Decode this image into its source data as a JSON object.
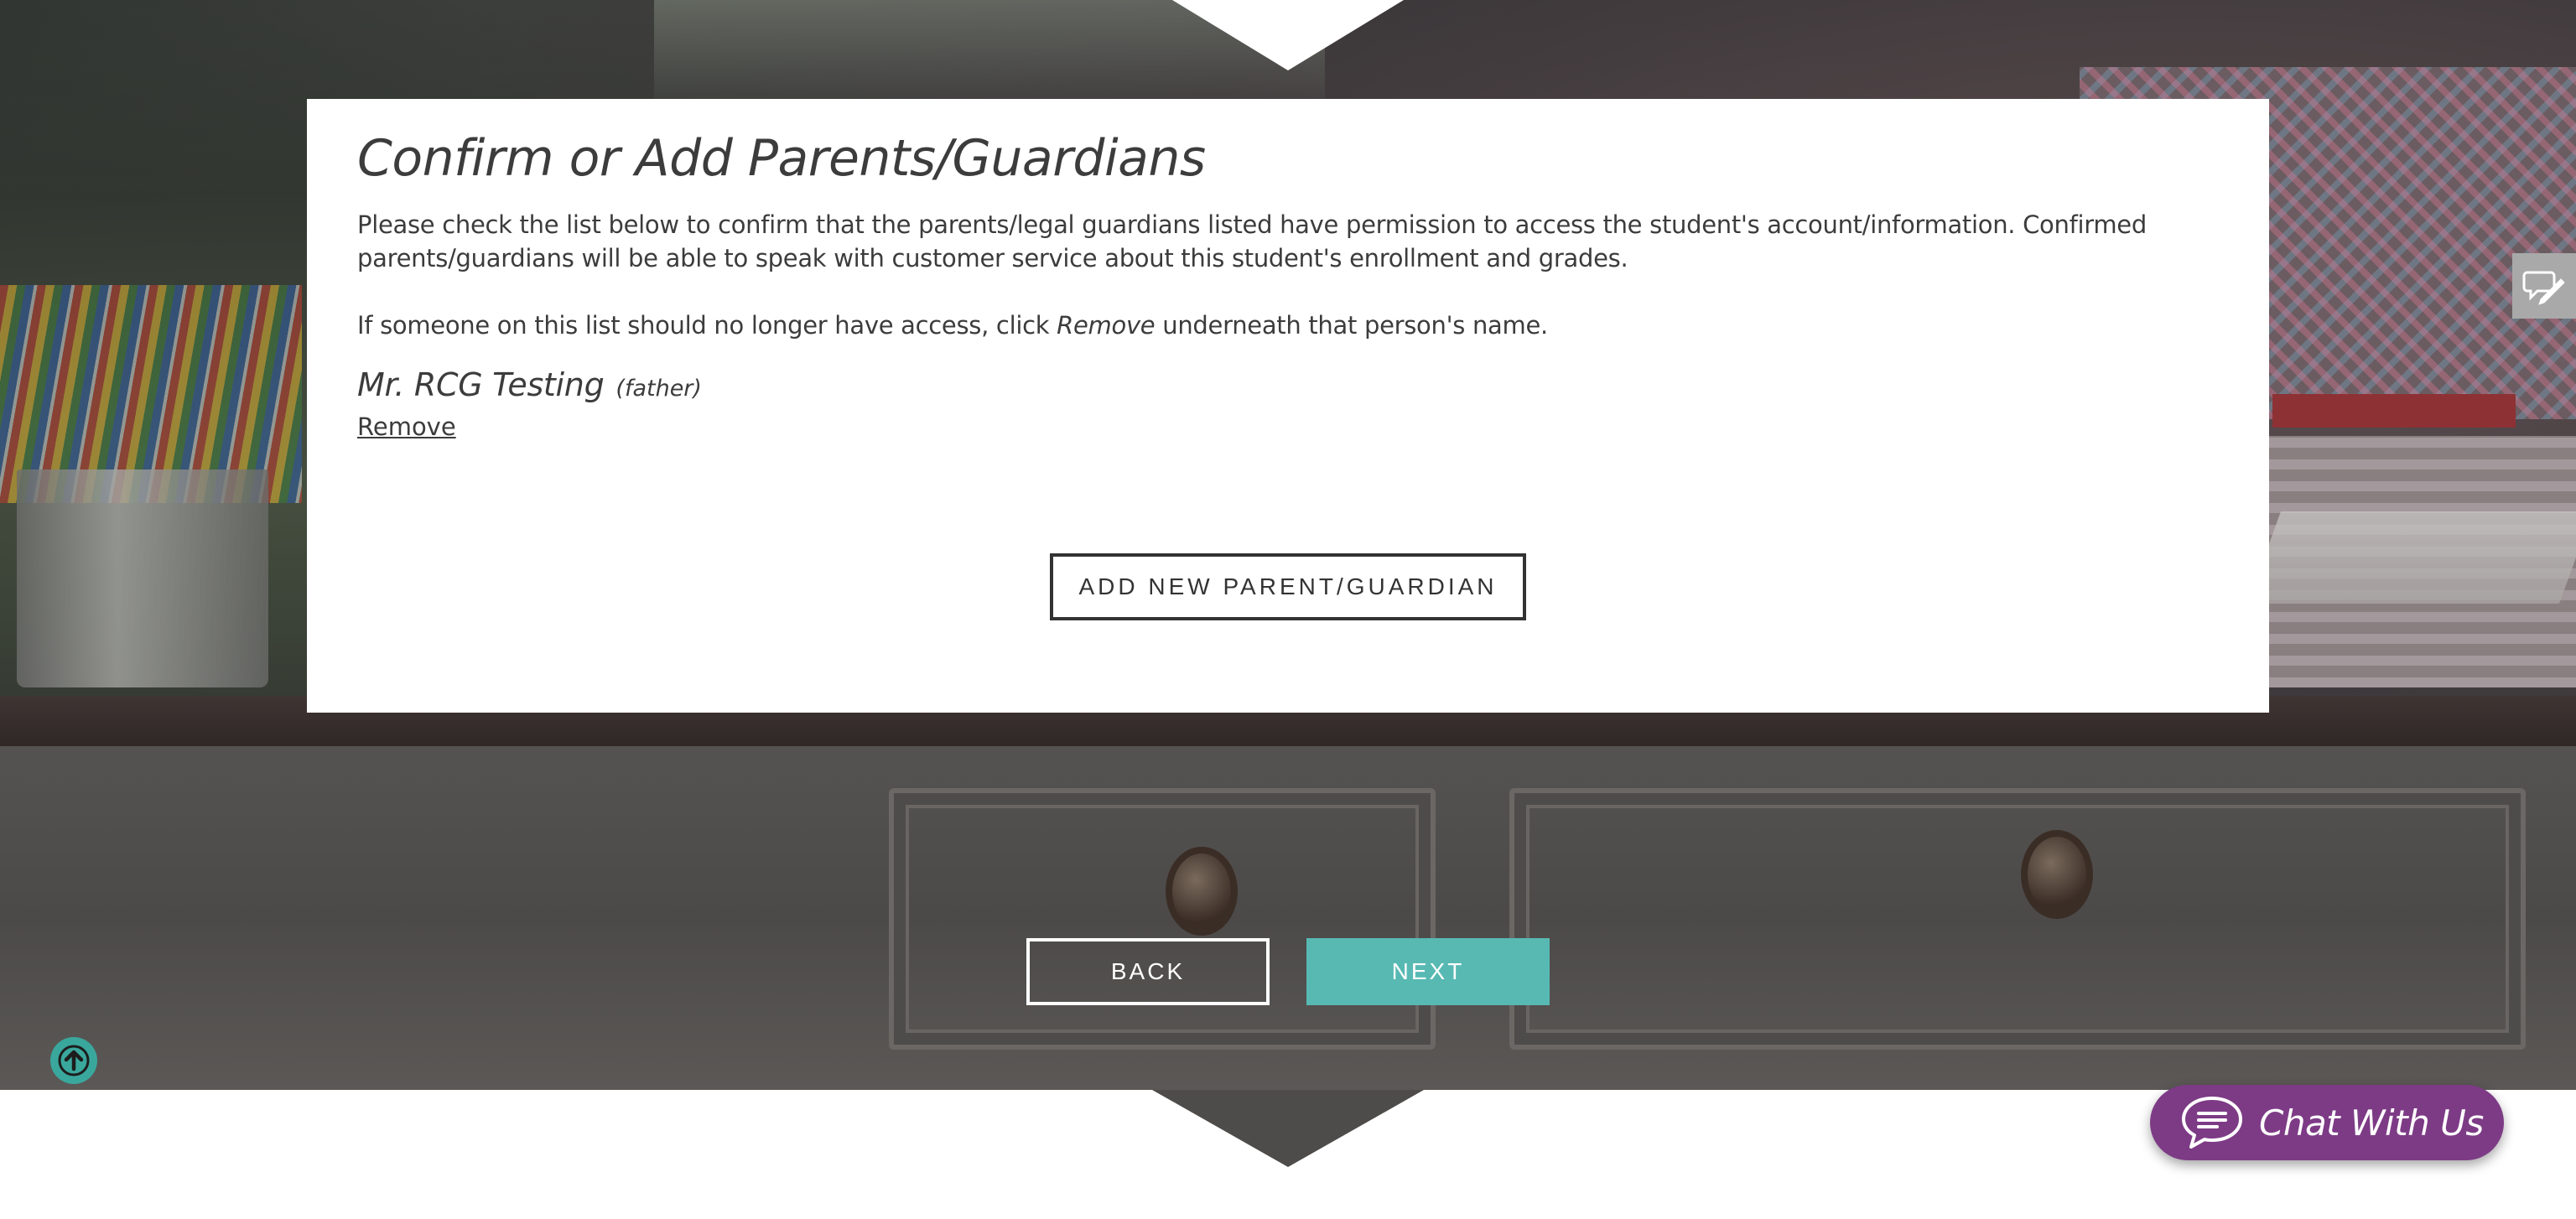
{
  "card": {
    "title": "Confirm or Add Parents/Guardians",
    "description": "Please check the list below to confirm that the parents/legal guardians listed have permission to access the student's account/information. Confirmed parents/guardians will be able to speak with customer service about this student's enrollment and grades.",
    "instruction_before": "If someone on this list should no longer have access, click ",
    "instruction_emphasis": "Remove",
    "instruction_after": " underneath that person's name.",
    "guardians": [
      {
        "name": "Mr. RCG Testing",
        "relation": "(father)",
        "remove_label": "Remove"
      }
    ],
    "add_button_label": "ADD NEW PARENT/GUARDIAN"
  },
  "nav": {
    "back_label": "BACK",
    "next_label": "NEXT"
  },
  "chat": {
    "label": "Chat With Us"
  },
  "icons": {
    "scroll_top": "arrow-up-icon",
    "side_tab": "feedback-icon",
    "chat": "chat-bubble-icon"
  },
  "colors": {
    "accent_teal": "#58b9b3",
    "scroll_top_teal": "#3aa79d",
    "chat_purple": "#7d3b86",
    "text_dark": "#3c3c3c"
  }
}
